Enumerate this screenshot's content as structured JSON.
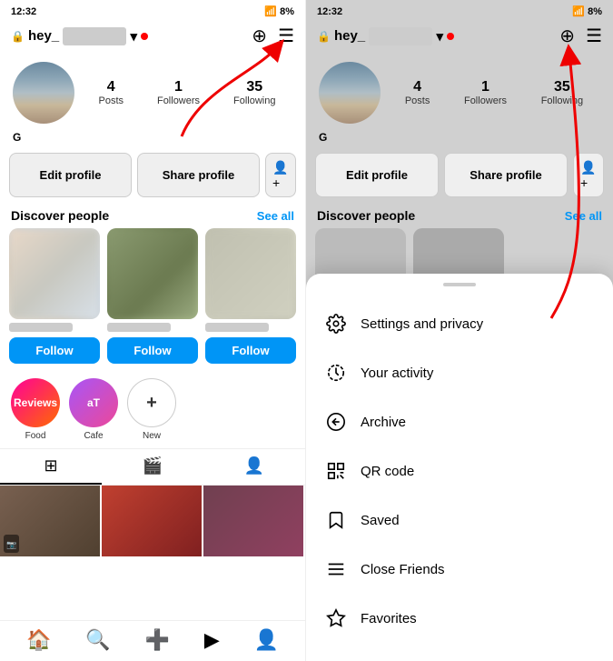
{
  "left": {
    "statusBar": {
      "time": "12:32",
      "battery": "8%"
    },
    "topNav": {
      "lock": "🔒",
      "username": "hey_",
      "chevron": "▾",
      "addIcon": "⊕",
      "menuIcon": "☰"
    },
    "profile": {
      "posts": {
        "count": "4",
        "label": "Posts"
      },
      "followers": {
        "count": "1",
        "label": "Followers"
      },
      "following": {
        "count": "35",
        "label": "Following"
      },
      "name": "G"
    },
    "buttons": {
      "editProfile": "Edit profile",
      "shareProfile": "Share profile"
    },
    "discover": {
      "title": "Discover people",
      "seeAll": "See all"
    },
    "follow": "Follow",
    "stories": [
      {
        "label": "Food",
        "text": "Reviews",
        "type": "food"
      },
      {
        "label": "Cafe",
        "text": "aT",
        "type": "cafe"
      },
      {
        "label": "New",
        "text": "+",
        "type": "new"
      }
    ],
    "bottomNav": [
      "🏠",
      "🔍",
      "➕",
      "▶",
      "👤"
    ]
  },
  "right": {
    "statusBar": {
      "time": "12:32",
      "battery": "8%"
    },
    "topNav": {
      "lock": "🔒",
      "username": "hey_",
      "addIcon": "⊕",
      "menuIcon": "☰"
    },
    "profile": {
      "posts": {
        "count": "4",
        "label": "Posts"
      },
      "followers": {
        "count": "1",
        "label": "Followers"
      },
      "following": {
        "count": "35",
        "label": "Following"
      },
      "name": "G"
    },
    "buttons": {
      "editProfile": "Edit profile",
      "shareProfile": "Share profile"
    },
    "discover": {
      "title": "Discover people",
      "seeAll": "See all"
    },
    "sheet": {
      "items": [
        {
          "icon": "⚙",
          "label": "Settings and privacy",
          "id": "settings"
        },
        {
          "icon": "◑",
          "label": "Your activity",
          "id": "activity"
        },
        {
          "icon": "↺",
          "label": "Archive",
          "id": "archive"
        },
        {
          "icon": "⊞",
          "label": "QR code",
          "id": "qrcode"
        },
        {
          "icon": "◻",
          "label": "Saved",
          "id": "saved"
        },
        {
          "icon": "≡",
          "label": "Close Friends",
          "id": "close-friends"
        },
        {
          "icon": "★",
          "label": "Favorites",
          "id": "favorites"
        }
      ]
    }
  }
}
